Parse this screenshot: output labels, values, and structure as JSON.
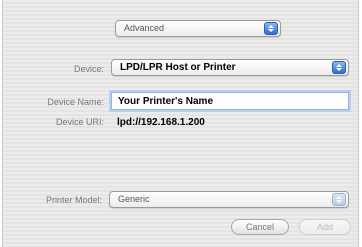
{
  "tabs_popup": {
    "selected": "Advanced"
  },
  "device": {
    "label": "Device:",
    "selected": "LPD/LPR Host or Printer"
  },
  "device_name": {
    "label": "Device Name:",
    "value": "Your Printer's Name"
  },
  "device_uri": {
    "label": "Device URI:",
    "value": "lpd://192.168.1.200"
  },
  "printer_model": {
    "label": "Printer Model:",
    "selected": "Generic"
  },
  "buttons": {
    "cancel": "Cancel",
    "add": "Add"
  }
}
